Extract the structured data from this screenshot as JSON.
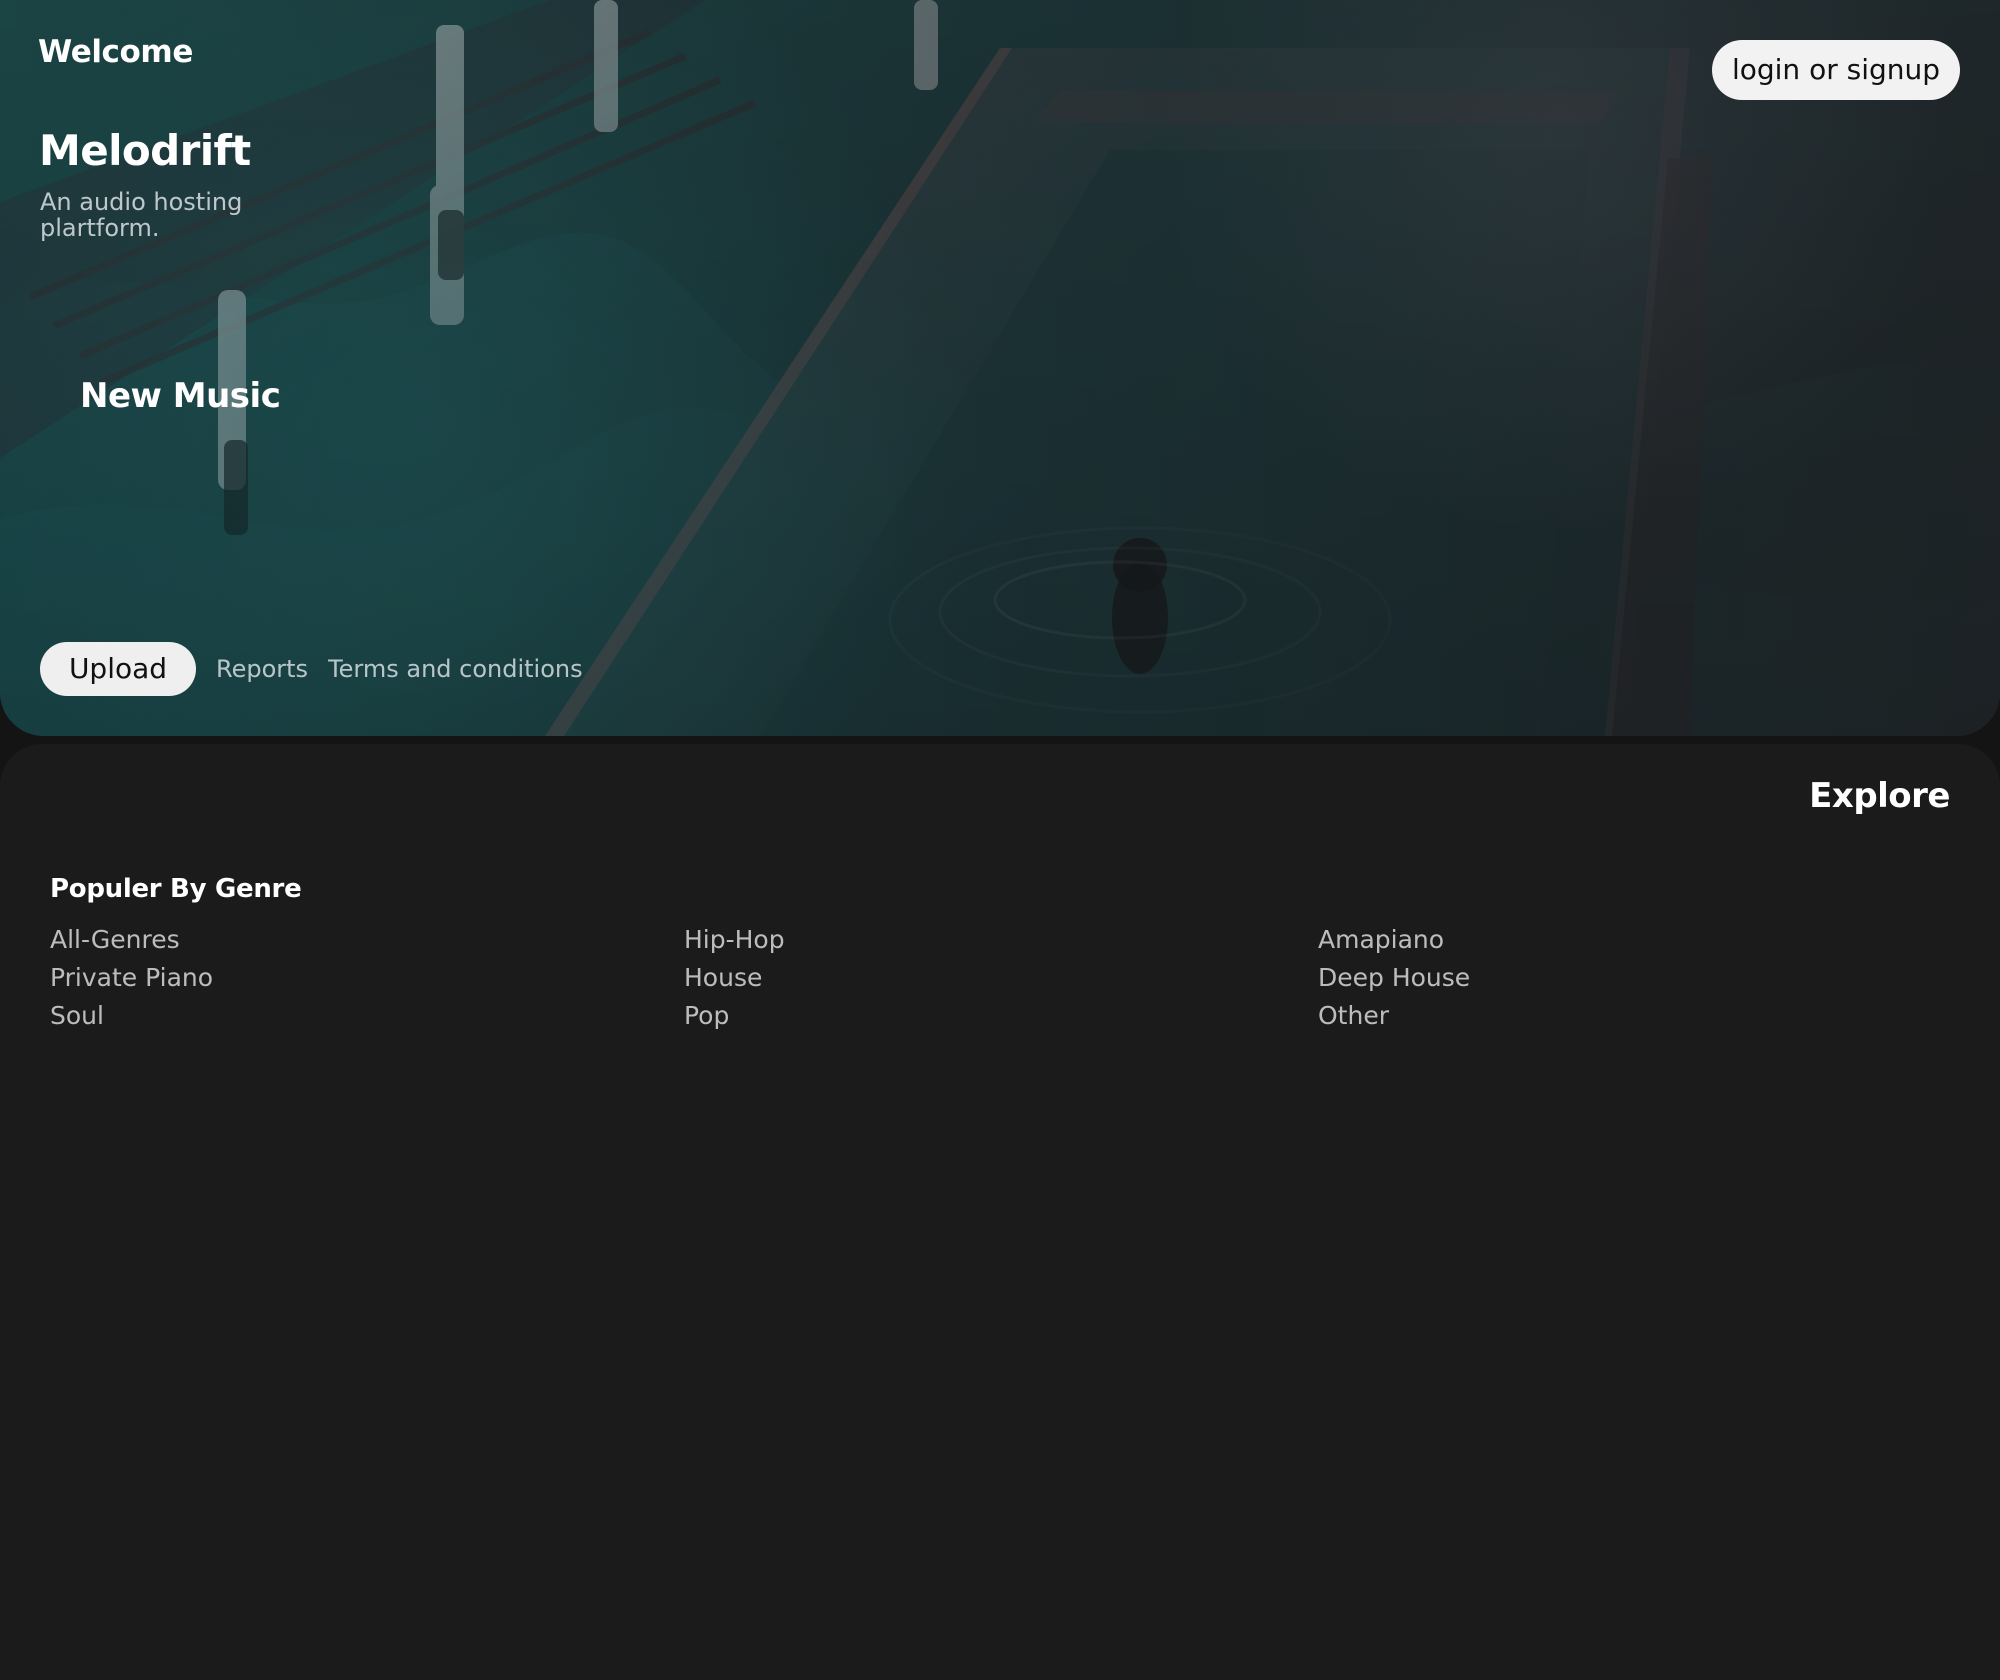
{
  "header": {
    "welcome": "Welcome",
    "login_label": "login or signup"
  },
  "hero": {
    "brand": "Melodrift",
    "tagline": "An audio hosting plartform.",
    "section_title": "New Music"
  },
  "hero_actions": {
    "upload_label": "Upload",
    "reports_label": "Reports",
    "terms_label": "Terms and conditions"
  },
  "explore": {
    "title": "Explore",
    "genre_title": "Populer By Genre",
    "genres": [
      "All-Genres",
      "Hip-Hop",
      "Amapiano",
      "Private Piano",
      "House",
      "Deep House",
      "Soul",
      "Pop",
      "Other"
    ]
  },
  "colors": {
    "page_background": "#1b1b1b",
    "hero_tint": "#17383c",
    "button_background": "#efefef",
    "text_primary": "#ffffff"
  }
}
